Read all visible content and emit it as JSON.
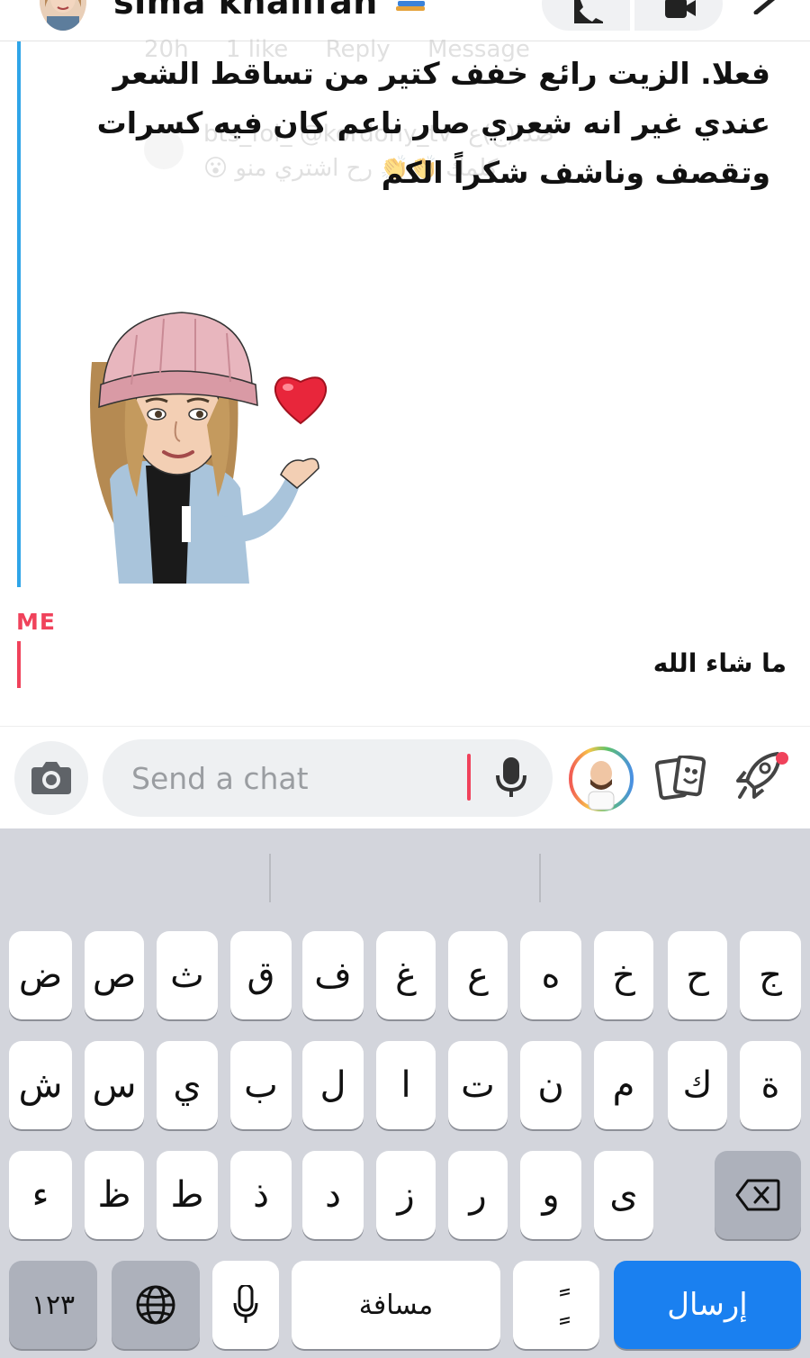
{
  "header": {
    "contact_name": "sima khalifah",
    "emoji": "books-emoji"
  },
  "ghost": {
    "bar_time": "20h",
    "bar_like": "1 like",
    "bar_reply": "Reply",
    "bar_message": "Message",
    "reply_user": "bts_fol_ @kordony_tv",
    "reply_text": "كلمك 👏👏 رح اشتري منو 😮",
    "reply_small": "صدا(ج)ع"
  },
  "conversation": {
    "friend_message": "فعلا. الزيت رائع خفف كتير من تساقط الشعر عندي غير انه شعري صار ناعم كان فيه كسرات وتقصف وناشف شكراً الكم",
    "me_label": "ME",
    "my_message": "ما شاء الله"
  },
  "input": {
    "placeholder": "Send a chat"
  },
  "keyboard": {
    "row1": [
      "ض",
      "ص",
      "ث",
      "ق",
      "ف",
      "غ",
      "ع",
      "ه",
      "خ",
      "ح",
      "ج"
    ],
    "row2": [
      "ش",
      "س",
      "ي",
      "ب",
      "ل",
      "ا",
      "ت",
      "ن",
      "م",
      "ك",
      "ة"
    ],
    "row3": [
      "ء",
      "ظ",
      "ط",
      "ذ",
      "د",
      "ز",
      "ر",
      "و",
      "ى"
    ],
    "numbers_key": "١٢٣",
    "space_key": "مسافة",
    "diacritic_key": "ًٍ",
    "send_key": "إرسال"
  },
  "colors": {
    "friend_accent": "#2fa5e8",
    "me_accent": "#f0425b",
    "send_blue": "#1a80f0",
    "keyboard_bg": "#d3d5dc"
  }
}
